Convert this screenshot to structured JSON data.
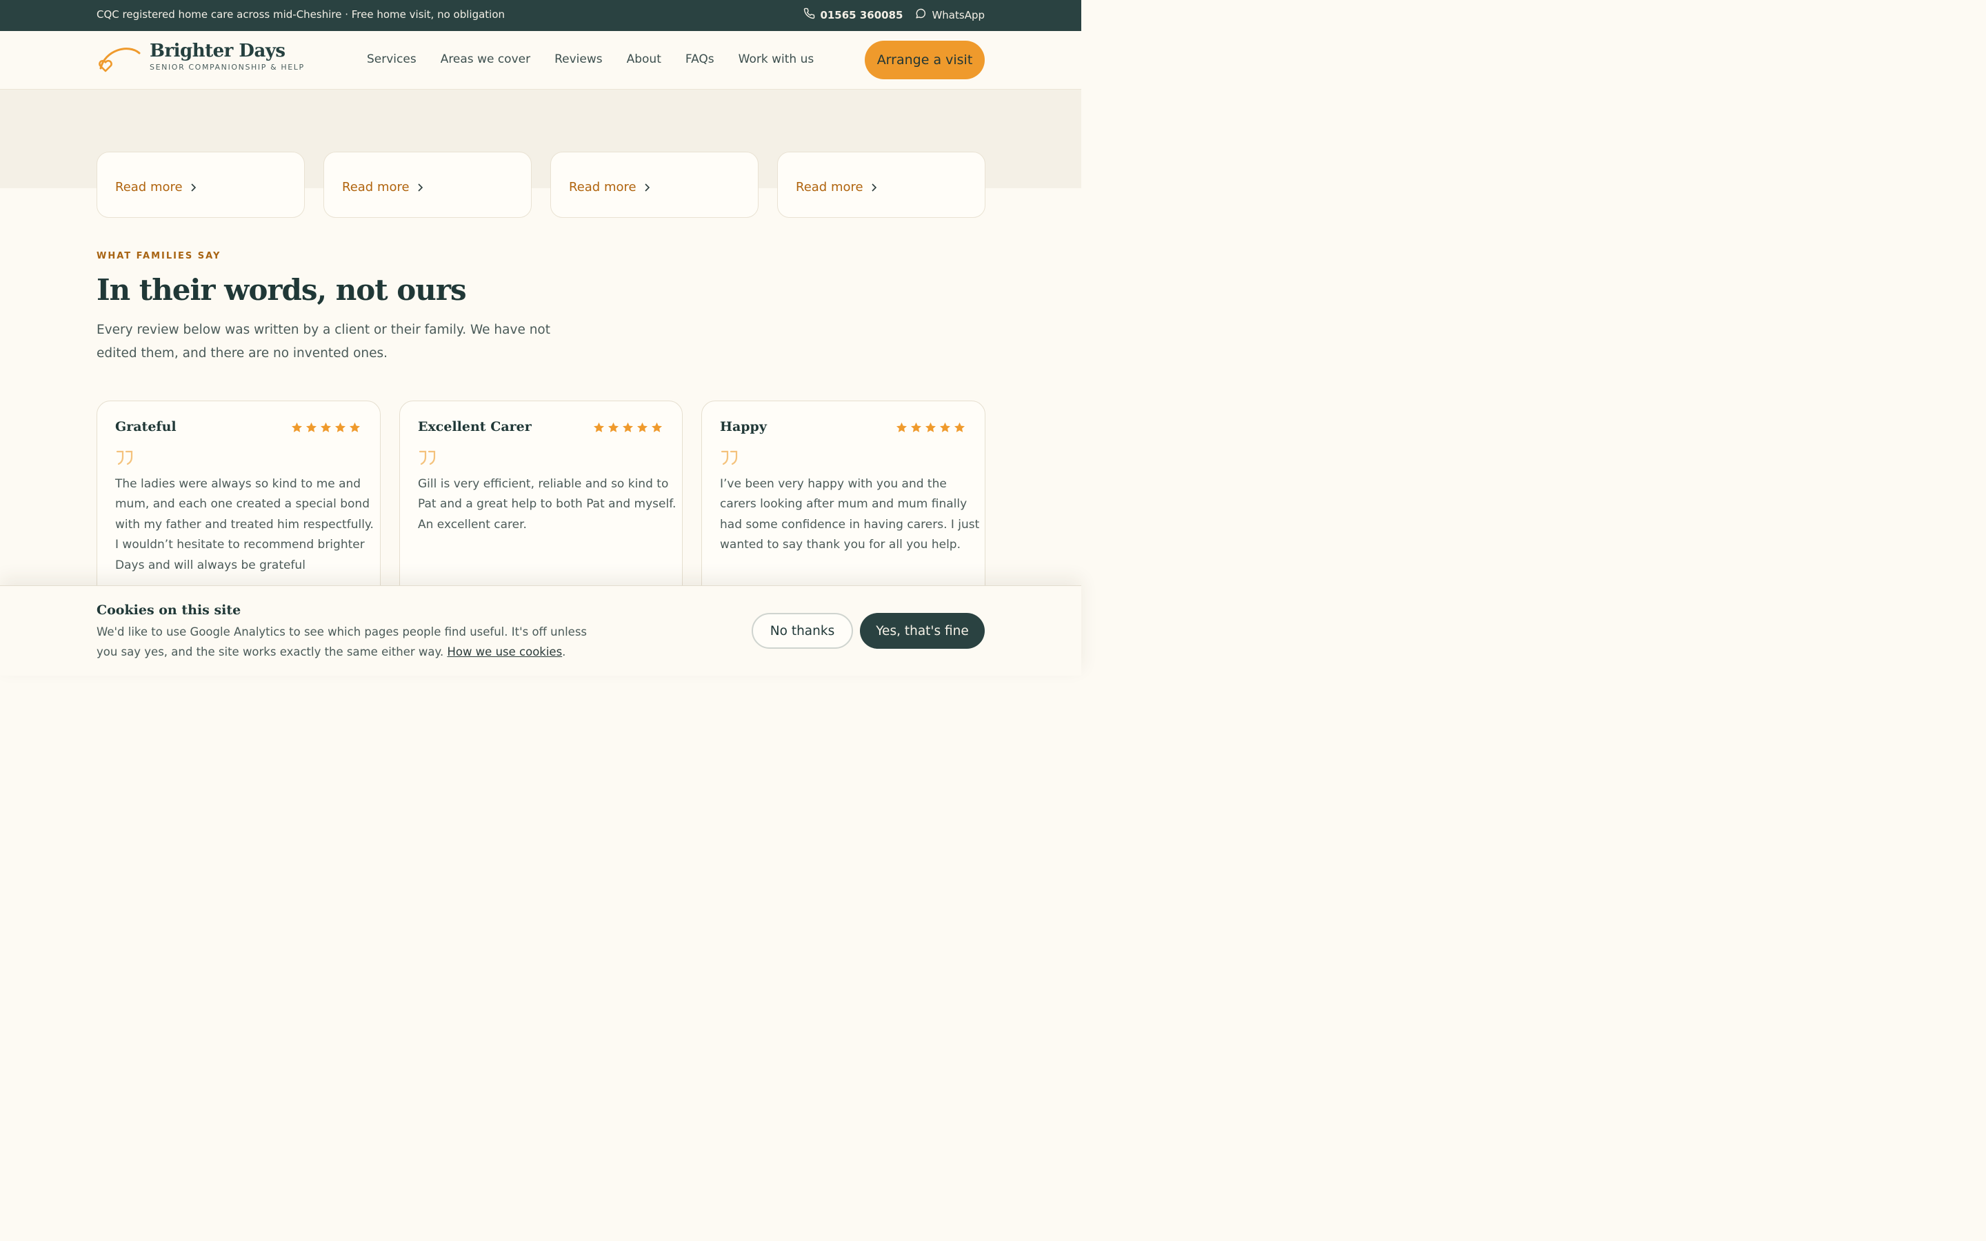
{
  "topbar": {
    "message": "CQC registered home care across mid-Cheshire · Free home visit, no obligation",
    "phone": "01565 360085",
    "whatsapp": "WhatsApp"
  },
  "brand": {
    "name": "Brighter Days",
    "tagline": "SENIOR COMPANIONSHIP & HELP",
    "accent": "#ef9a2c",
    "dark": "#2a4241"
  },
  "nav": {
    "items": [
      "Services",
      "Areas we cover",
      "Reviews",
      "About",
      "FAQs",
      "Work with us"
    ],
    "cta": "Arrange a visit"
  },
  "services": {
    "read_more": [
      "Read more",
      "Read more",
      "Read more",
      "Read more"
    ]
  },
  "testimonials": {
    "eyebrow": "WHAT FAMILIES SAY",
    "heading": "In their words, not ours",
    "lead": "Every review below was written by a client or their family. We have not edited them, and there are no invented ones.",
    "reviews": [
      {
        "title": "Grateful",
        "rating": 5,
        "text_lines": [
          "The ladies were always so kind to me and",
          "mum, and each one created a special bond",
          "with my father and treated him respectfully.",
          "I wouldn’t hesitate to recommend brighter",
          "Days and will always be grateful"
        ]
      },
      {
        "title": "Excellent Carer",
        "rating": 5,
        "text_lines": [
          "Gill is very efficient, reliable and so kind to",
          "Pat and a great help to both Pat and myself.",
          "An excellent carer."
        ]
      },
      {
        "title": "Happy",
        "rating": 5,
        "text_lines": [
          "I’ve been very happy with you and the",
          "carers looking after mum and mum finally",
          "had some confidence in having carers. I just",
          "wanted to say thank you for all you help."
        ]
      }
    ]
  },
  "cookie": {
    "title": "Cookies on this site",
    "body": "We'd like to use Google Analytics to see which pages people find useful. It's off unless you say yes, and the site works exactly the same either way. ",
    "link": "How we use cookies",
    "after_link": ".",
    "decline": "No thanks",
    "accept": "Yes, that's fine"
  }
}
